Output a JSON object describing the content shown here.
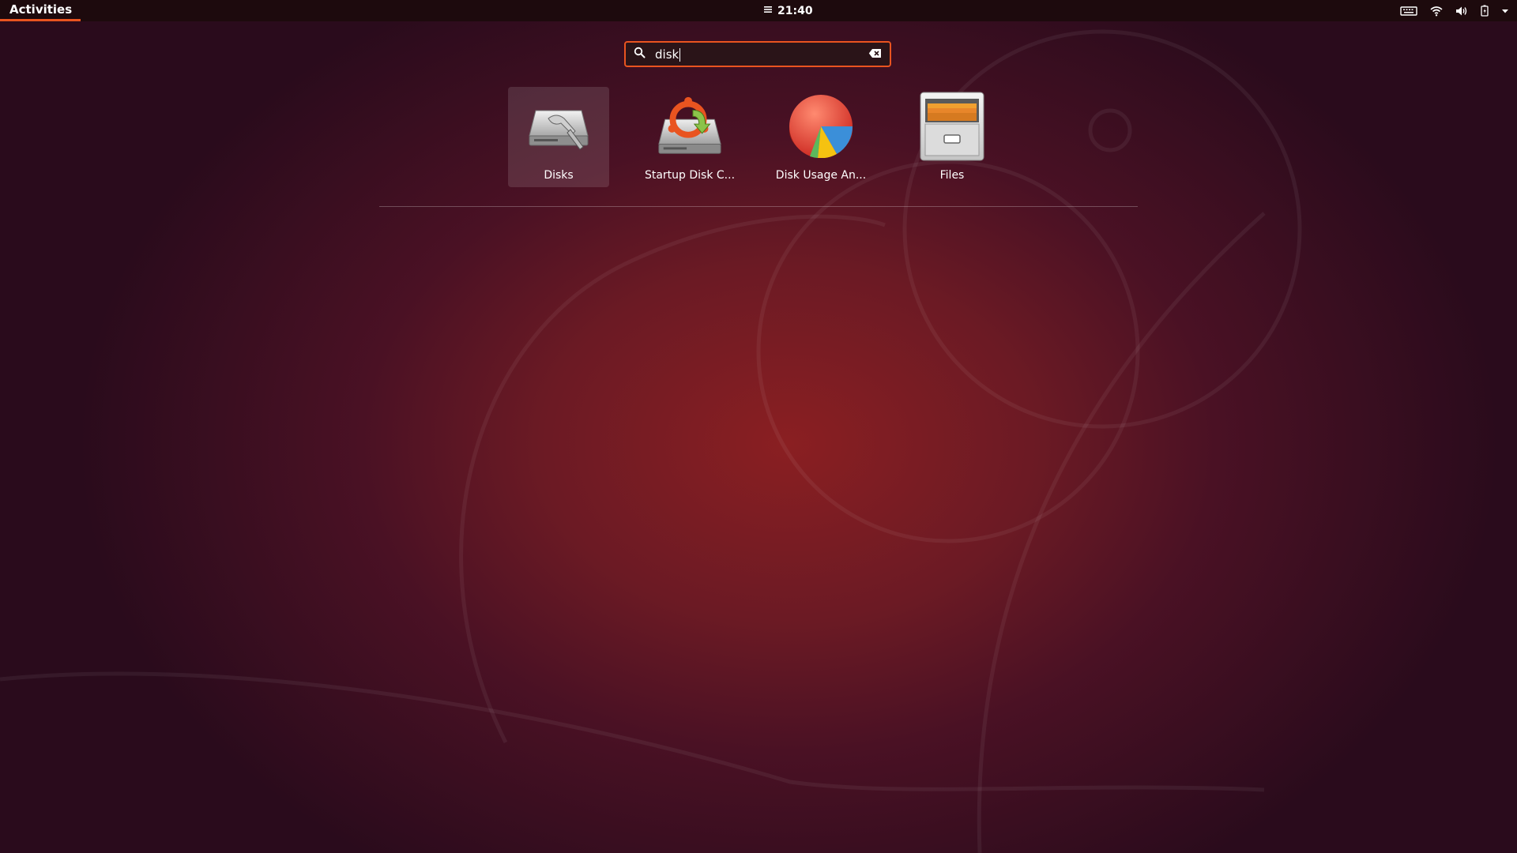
{
  "topbar": {
    "activities_label": "Activities",
    "clock": "21:40",
    "tray_icons": [
      "keyboard-icon",
      "wifi-icon",
      "volume-icon",
      "battery-icon",
      "system-menu-arrow-icon"
    ]
  },
  "search": {
    "value": "disk",
    "icon": "search-icon",
    "clear_icon": "clear-text-icon"
  },
  "results": [
    {
      "label": "Disks",
      "icon": "disks-icon",
      "selected": true
    },
    {
      "label": "Startup Disk C...",
      "icon": "startup-disk-creator-icon",
      "selected": false
    },
    {
      "label": "Disk Usage An...",
      "icon": "disk-usage-analyzer-icon",
      "selected": false
    },
    {
      "label": "Files",
      "icon": "files-icon",
      "selected": false
    }
  ],
  "colors": {
    "accent": "#e95420",
    "topbar_bg": "#1d0a0d"
  }
}
